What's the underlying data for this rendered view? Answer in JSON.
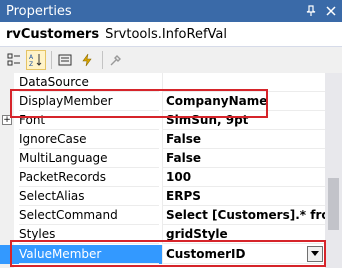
{
  "window": {
    "title": "Properties"
  },
  "object": {
    "name": "rvCustomers",
    "type": "Srvtools.InfoRefVal"
  },
  "toolbar": {
    "buttons": [
      {
        "icon": "categorized-icon",
        "active": false
      },
      {
        "icon": "alphabetical-icon",
        "active": true
      },
      {
        "icon": "properties-icon",
        "active": false
      },
      {
        "icon": "events-icon",
        "active": false
      },
      {
        "icon": "property-pages-icon",
        "active": false
      }
    ]
  },
  "properties": [
    {
      "name": "DataSource",
      "value": ""
    },
    {
      "name": "DisplayMember",
      "value": "CompanyName"
    },
    {
      "name": "Font",
      "value": "SimSun, 9pt",
      "expandable": true
    },
    {
      "name": "IgnoreCase",
      "value": "False"
    },
    {
      "name": "MultiLanguage",
      "value": "False"
    },
    {
      "name": "PacketRecords",
      "value": "100"
    },
    {
      "name": "SelectAlias",
      "value": "ERPS"
    },
    {
      "name": "SelectCommand",
      "value": "Select [Customers].* from"
    },
    {
      "name": "Styles",
      "value": "gridStyle"
    },
    {
      "name": "ValueMember",
      "value": "CustomerID",
      "selected": true
    }
  ],
  "colors": {
    "titlebar": "#3a6aa8",
    "selection": "#3399ff",
    "highlight": "#d6242a"
  }
}
